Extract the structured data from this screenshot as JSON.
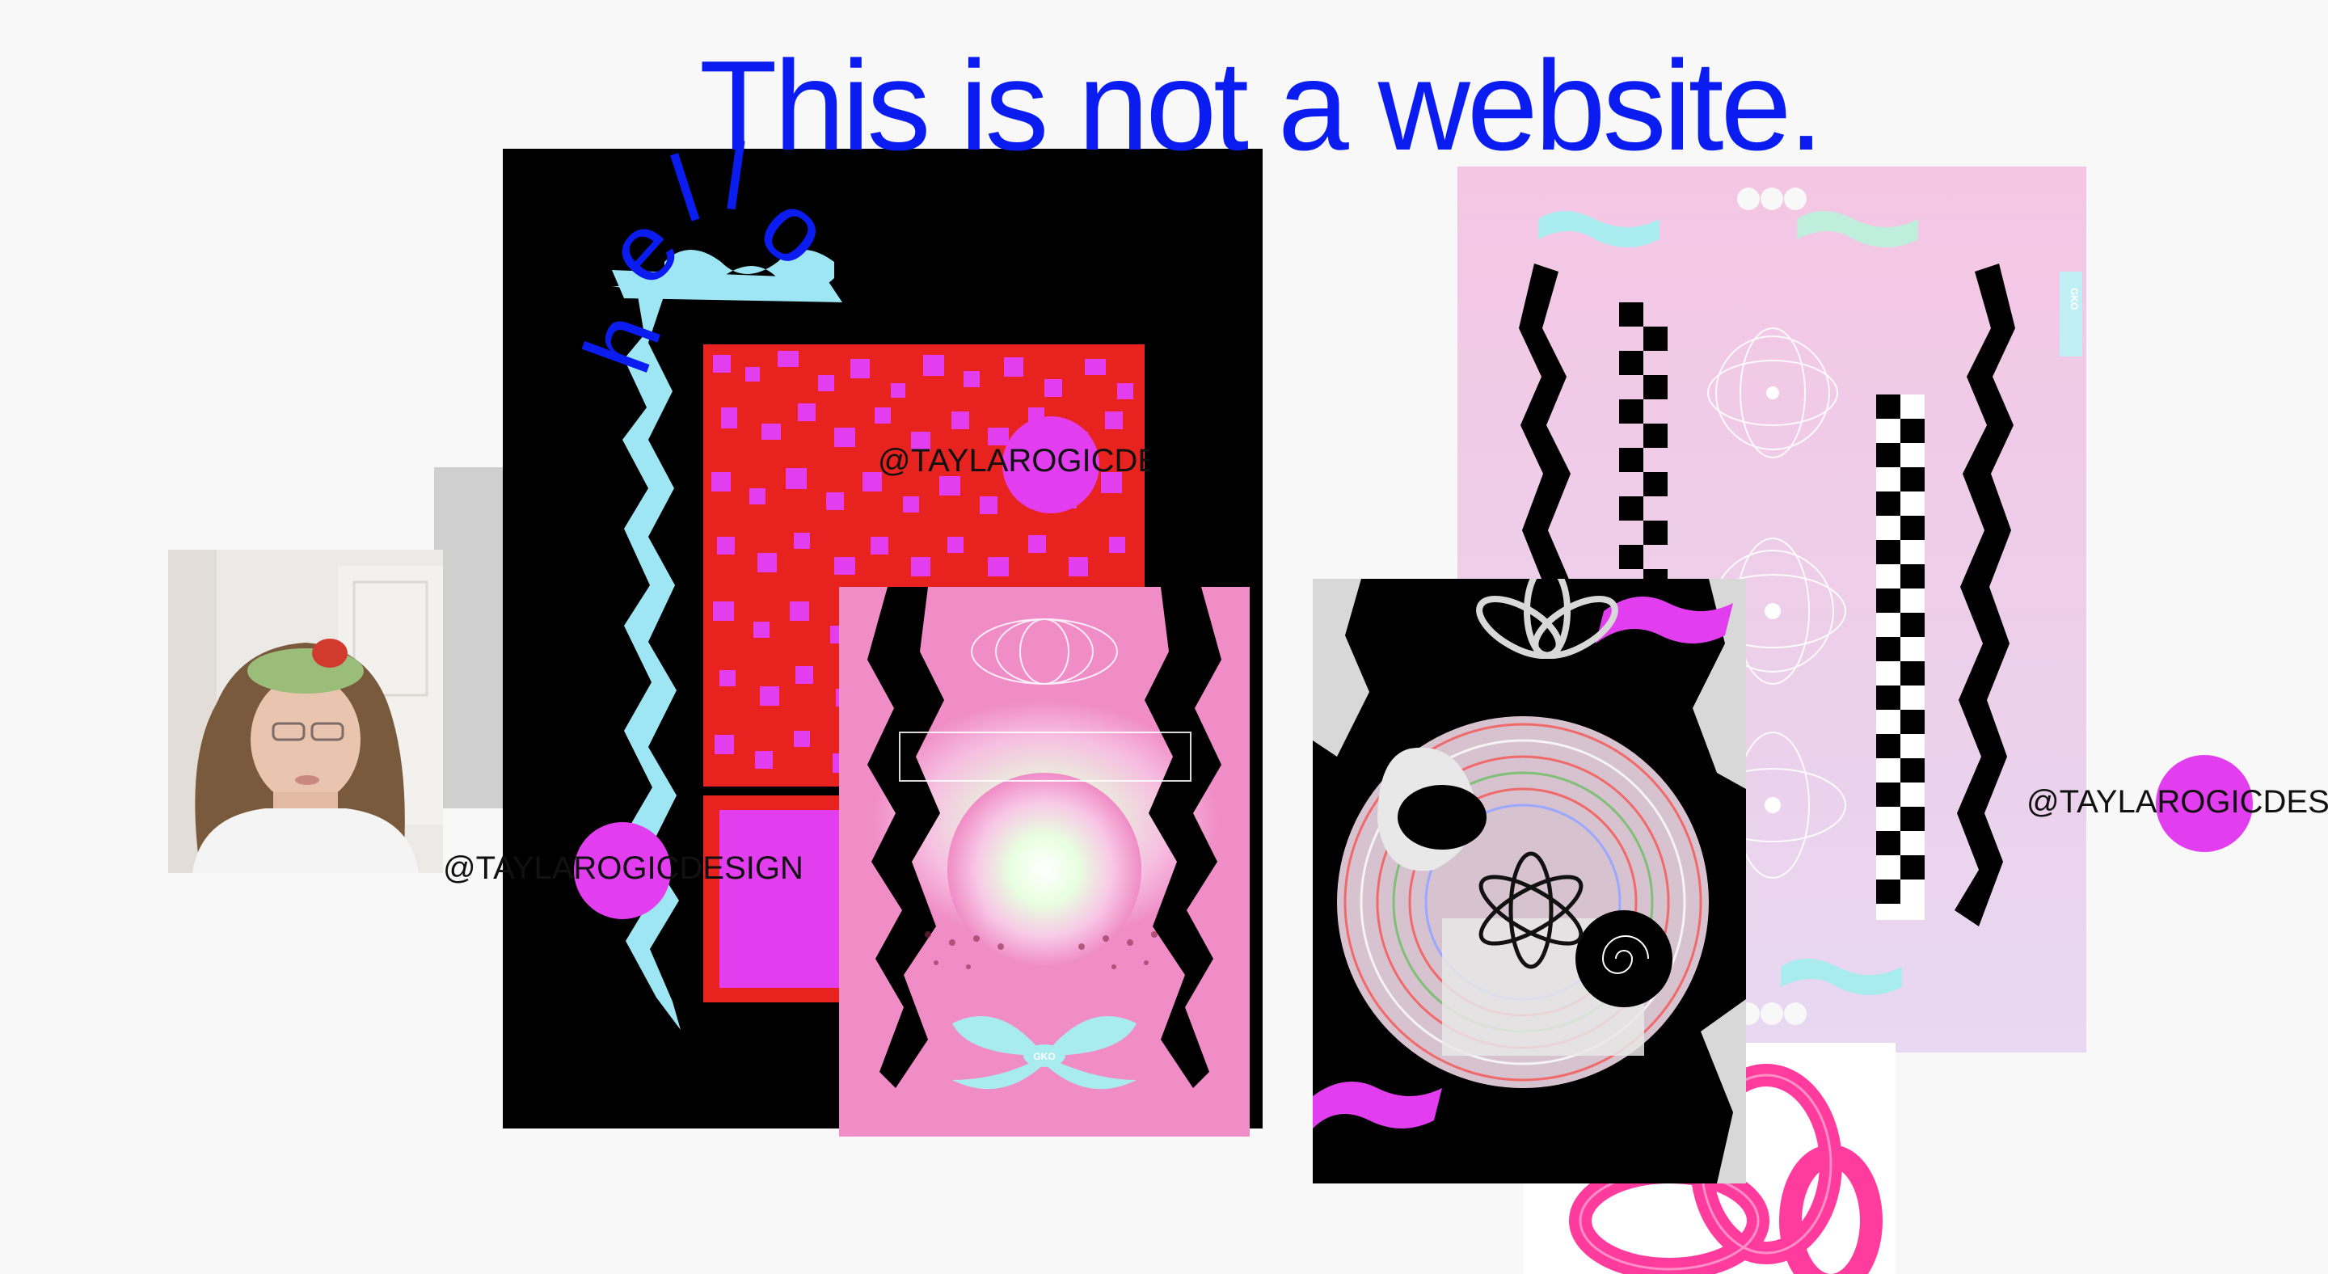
{
  "headline": "This is not a website.",
  "hello_letters": [
    "h",
    "e",
    "l",
    "l",
    "o"
  ],
  "handles": {
    "left": "@TAYLAROGICDESIGN",
    "center": "@TAYLAROGICDE",
    "right": "@TAYLAROGICDES"
  },
  "poster_badges": {
    "pink_poster": "GKO",
    "lavender_poster": "GKO"
  },
  "colors": {
    "headline_blue": "#0a1cf0",
    "magenta_dot": "#e23ef0",
    "background": "#f8f8f8",
    "cyan_accent": "#9ee6f4",
    "pink_poster": "#f08cc6",
    "hot_pink": "#ff3c9e"
  }
}
